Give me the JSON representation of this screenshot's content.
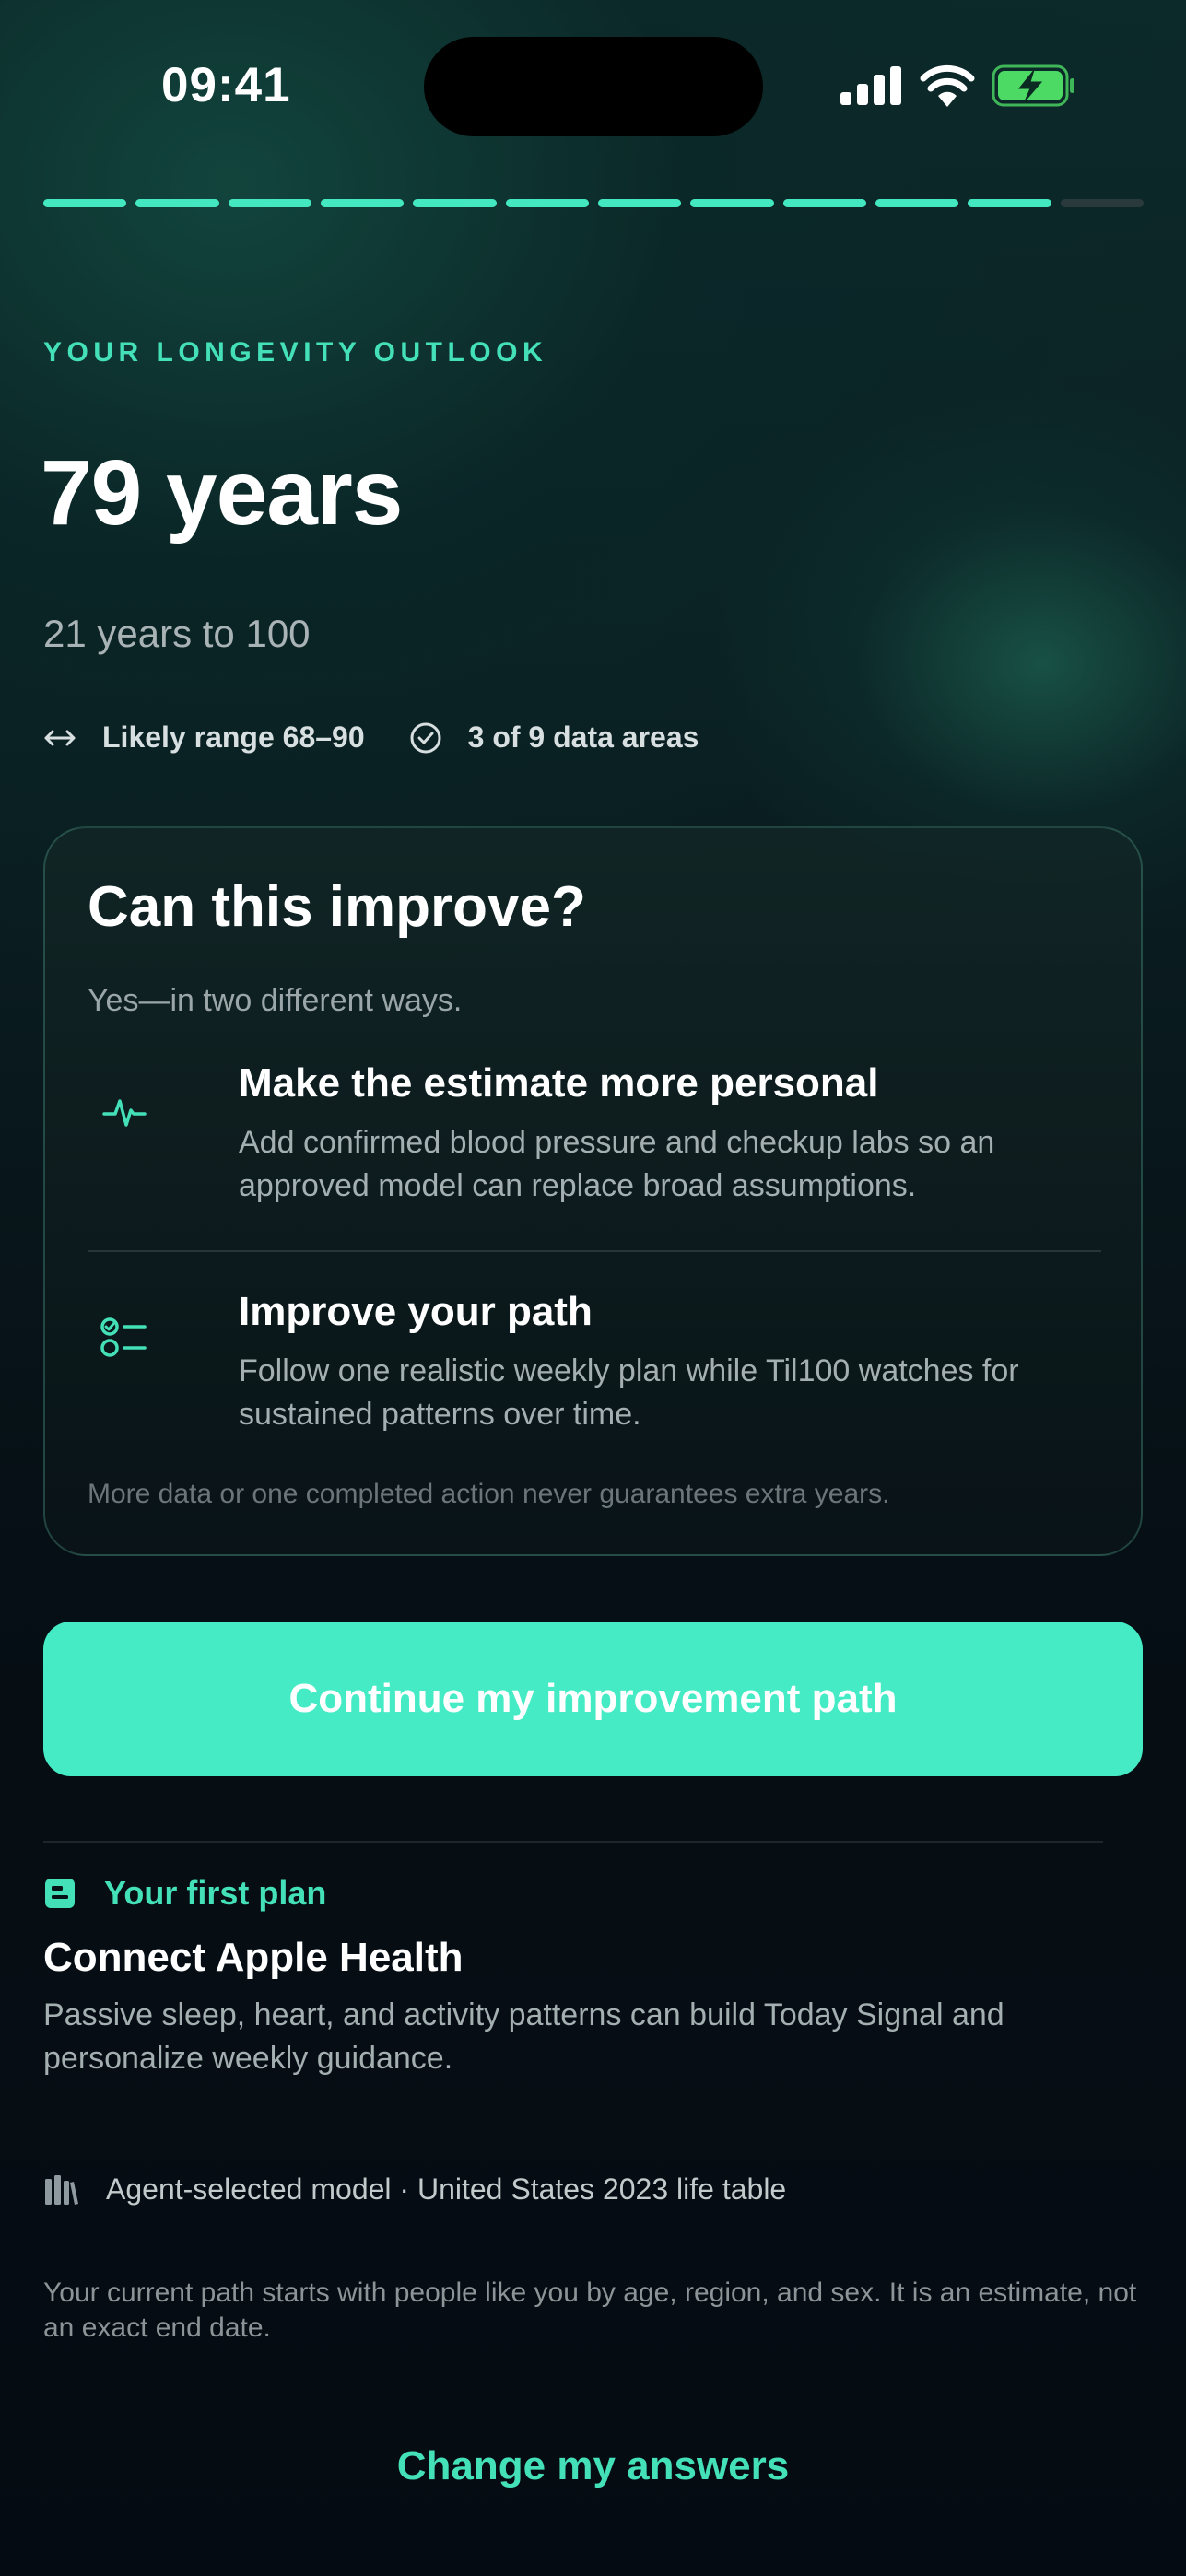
{
  "status_bar": {
    "time": "09:41"
  },
  "progress": {
    "total_steps": 12,
    "completed_steps": 11
  },
  "outlook": {
    "eyebrow": "YOUR LONGEVITY OUTLOOK",
    "headline": "79 years",
    "subline": "21 years to 100",
    "likely_range": "Likely range 68–90",
    "data_areas": "3 of 9 data areas"
  },
  "card": {
    "title": "Can this improve?",
    "subtitle": "Yes—in two different ways.",
    "items": [
      {
        "icon": "pulse-icon",
        "title": "Make the estimate more personal",
        "description": "Add confirmed blood pressure and checkup labs so an approved model can replace broad assumptions."
      },
      {
        "icon": "checklist-icon",
        "title": "Improve your path",
        "description": "Follow one realistic weekly plan while Til100 watches for sustained patterns over time."
      }
    ],
    "footnote": "More data or one completed action never guarantees extra years."
  },
  "cta": {
    "label": "Continue my improvement path"
  },
  "plan": {
    "badge": "Your first plan",
    "title": "Connect Apple Health",
    "description": "Passive sleep, heart, and activity patterns can build Today Signal and personalize weekly guidance."
  },
  "model": {
    "label": "Agent-selected model · United States 2023 life table"
  },
  "footnote": "Your current path starts with people like you by age, region, and sex. It is an estimate, not an exact end date.",
  "change_link": "Change my answers",
  "colors": {
    "accent": "#44e0b8",
    "cta_background": "#44ebc4",
    "battery_green": "#4cd964"
  }
}
